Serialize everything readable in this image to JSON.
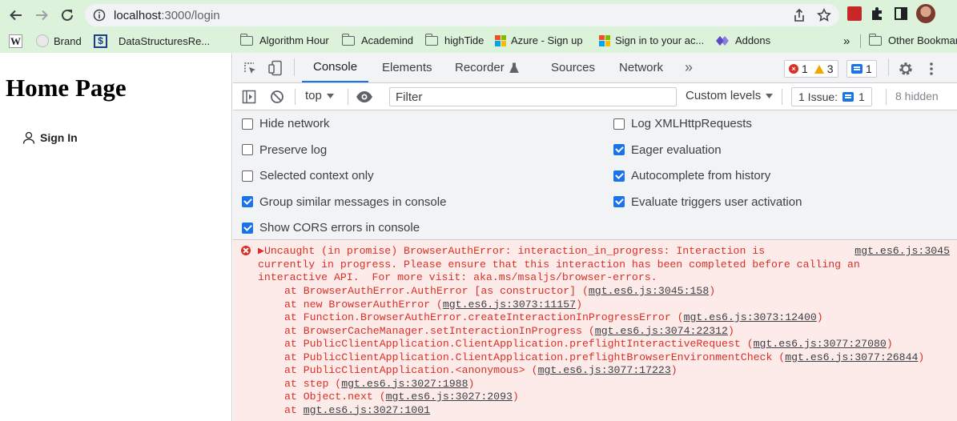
{
  "browser": {
    "url_host": "localhost",
    "url_path": ":3000/login",
    "bookmarks": [
      {
        "label": "",
        "icon": "wikipedia-icon"
      },
      {
        "label": "Brand",
        "icon": "pinterest-icon"
      },
      {
        "label": "DataStructuresRe...",
        "icon": "dollar-icon"
      },
      {
        "label": "Algorithm Hour",
        "icon": "folder-icon"
      },
      {
        "label": "Academind",
        "icon": "folder-icon"
      },
      {
        "label": "highTide",
        "icon": "folder-icon"
      },
      {
        "label": "Azure - Sign up",
        "icon": "microsoft-icon"
      },
      {
        "label": "Sign in to your ac...",
        "icon": "microsoft-icon"
      },
      {
        "label": "Addons",
        "icon": "addons-icon"
      }
    ],
    "more_label": "»",
    "other_bookmarks": "Other Bookmarks"
  },
  "page": {
    "title": "Home Page",
    "signin_label": "Sign In"
  },
  "devtools": {
    "tabs": [
      "Console",
      "Elements",
      "Recorder",
      "Sources",
      "Network"
    ],
    "more_tabs": "»",
    "error_count": "1",
    "warning_count": "3",
    "issue_count": "1",
    "context": "top",
    "filter_placeholder": "Filter",
    "levels": "Custom levels",
    "issues_label": "1 Issue:",
    "issues_count": "1",
    "hidden": "8 hidden",
    "settings_left": [
      {
        "label": "Hide network",
        "checked": false
      },
      {
        "label": "Preserve log",
        "checked": false
      },
      {
        "label": "Selected context only",
        "checked": false
      },
      {
        "label": "Group similar messages in console",
        "checked": true
      },
      {
        "label": "Show CORS errors in console",
        "checked": true
      }
    ],
    "settings_right": [
      {
        "label": "Log XMLHttpRequests",
        "checked": false
      },
      {
        "label": "Eager evaluation",
        "checked": true
      },
      {
        "label": "Autocomplete from history",
        "checked": true
      },
      {
        "label": "Evaluate triggers user activation",
        "checked": true
      }
    ],
    "error": {
      "source": "mgt.es6.js:3045",
      "message": "▶Uncaught (in promise) BrowserAuthError: interaction_in_progress: Interaction is\ncurrently in progress. Please ensure that this interaction has been completed before calling an\ninteractive API.  For more visit: aka.ms/msaljs/browser-errors.",
      "stack": [
        {
          "text": "at BrowserAuthError.AuthError [as constructor] (",
          "link": "mgt.es6.js:3045:158",
          "tail": ")"
        },
        {
          "text": "at new BrowserAuthError (",
          "link": "mgt.es6.js:3073:11157",
          "tail": ")"
        },
        {
          "text": "at Function.BrowserAuthError.createInteractionInProgressError (",
          "link": "mgt.es6.js:3073:12400",
          "tail": ")"
        },
        {
          "text": "at BrowserCacheManager.setInteractionInProgress (",
          "link": "mgt.es6.js:3074:22312",
          "tail": ")"
        },
        {
          "text": "at PublicClientApplication.ClientApplication.preflightInteractiveRequest (",
          "link": "mgt.es6.js:3077:27080",
          "tail": ")"
        },
        {
          "text": "at PublicClientApplication.ClientApplication.preflightBrowserEnvironmentCheck (",
          "link": "mgt.es6.js:3077:26844",
          "tail": ")"
        },
        {
          "text": "at PublicClientApplication.<anonymous> (",
          "link": "mgt.es6.js:3077:17223",
          "tail": ")"
        },
        {
          "text": "at step (",
          "link": "mgt.es6.js:3027:1988",
          "tail": ")"
        },
        {
          "text": "at Object.next (",
          "link": "mgt.es6.js:3027:2093",
          "tail": ")"
        },
        {
          "text": "at ",
          "link": "mgt.es6.js:3027:1001",
          "tail": ""
        }
      ]
    }
  }
}
